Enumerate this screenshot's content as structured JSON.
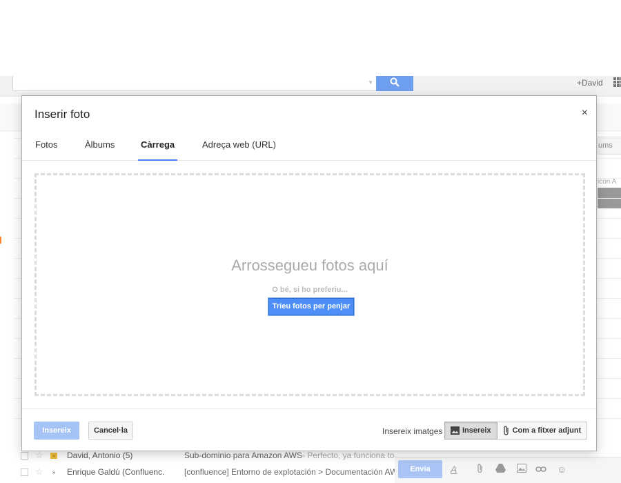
{
  "header": {
    "user_link": "+David"
  },
  "background": {
    "right_tab_label": "ums",
    "right_label": "icon A",
    "rows": [
      {
        "sender": "David, Antonio (5)",
        "subject": "Sub-dominio para Amazon AWS",
        "snippet": " - Perfecto, ya funciona to"
      },
      {
        "sender": "Enrique Galdú (Confluenc.",
        "subject": "[confluence] Entorno de explotación > Documentación AW",
        "snippet": ""
      }
    ],
    "compose": {
      "send_label": "Envia"
    }
  },
  "dialog": {
    "title": "Inserir foto",
    "close_glyph": "×",
    "tabs": [
      {
        "label": "Fotos",
        "active": false
      },
      {
        "label": "Àlbums",
        "active": false
      },
      {
        "label": "Càrrega",
        "active": true
      },
      {
        "label": "Adreça web (URL)",
        "active": false
      }
    ],
    "drop_zone": {
      "title": "Arrossegueu fotos aquí",
      "or_text": "O bé, si ho preferiu...",
      "choose_button": "Trieu fotos per penjar"
    },
    "footer": {
      "insert_button": "Insereix",
      "cancel_button": "Cancel·la",
      "insert_images_label": "Insereix imatges",
      "option_inline": "Insereix",
      "option_attachment": "Com a fitxer adjunt",
      "selected_option": "inline"
    }
  },
  "colors": {
    "accent": "#4285f4",
    "primary_button": "#4d8ff7",
    "disabled_button": "#a6c3f6"
  }
}
